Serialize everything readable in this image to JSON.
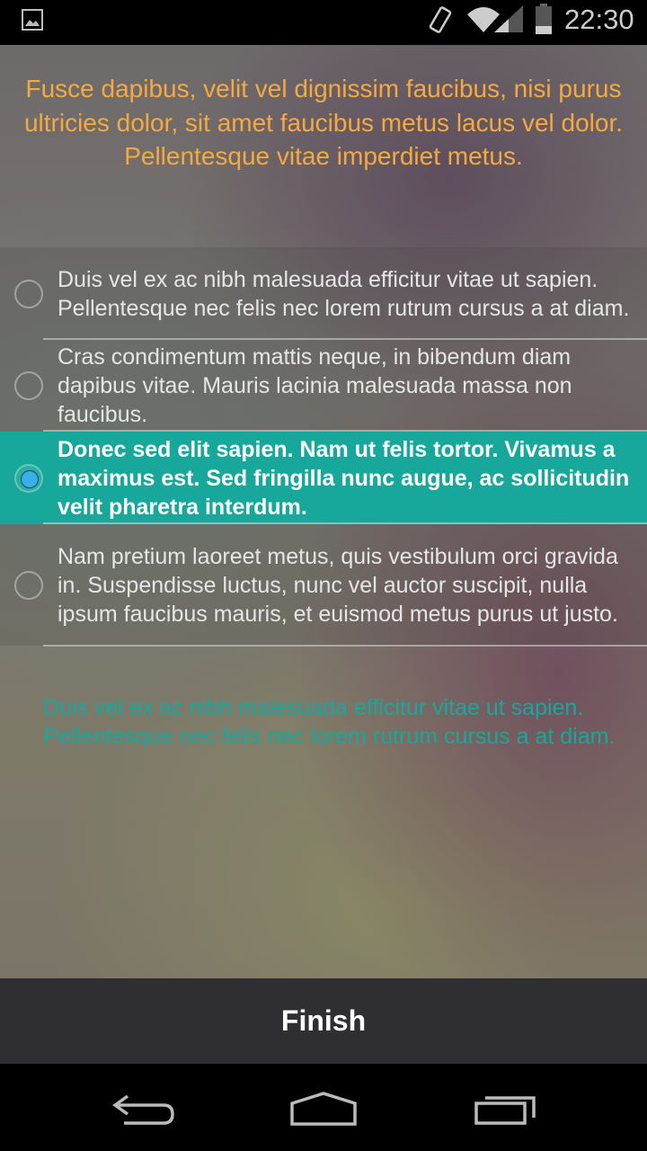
{
  "status_bar": {
    "time": "22:30",
    "icons": [
      "image-icon",
      "vibrate-icon",
      "wifi-icon",
      "signal-icon",
      "battery-icon"
    ]
  },
  "question": "Fusce dapibus, velit vel dignissim faucibus, nisi purus ultricies dolor, sit amet faucibus metus lacus vel dolor. Pellentesque vitae imperdiet metus.",
  "options": [
    {
      "label": " Duis vel ex ac nibh malesuada efficitur vitae ut sapien. Pellentesque nec felis nec lorem rutrum cursus a at diam.",
      "selected": false
    },
    {
      "label": "Cras condimentum mattis neque, in bibendum diam dapibus vitae. Mauris lacinia malesuada massa non faucibus.",
      "selected": false
    },
    {
      "label": "Donec sed elit sapien. Nam ut felis tortor. Vivamus a maximus est. Sed fringilla nunc augue, ac sollicitudin velit pharetra interdum.",
      "selected": true
    },
    {
      "label": "Nam pretium laoreet metus, quis vestibulum orci gravida in. Suspendisse luctus, nunc vel auctor suscipit, nulla ipsum faucibus mauris, et euismod metus purus ut justo.",
      "selected": false
    }
  ],
  "feedback": " Duis vel ex ac nibh malesuada efficitur vitae ut sapien. Pellentesque nec felis nec lorem rutrum cursus a at diam.",
  "finish_label": "Finish",
  "colors": {
    "accent": "#17a89b",
    "question": "#f5a941",
    "radio_selected": "#3aaee8",
    "finish_bar": "#2e2e33"
  }
}
